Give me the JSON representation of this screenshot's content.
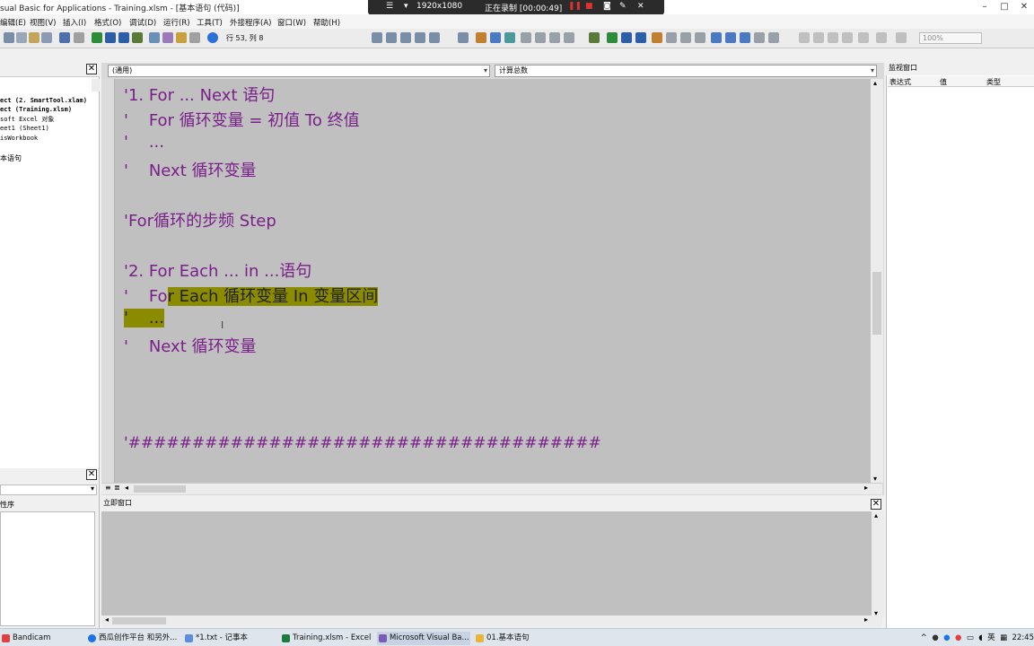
{
  "window": {
    "title": "sual Basic for Applications - Training.xlsm - [基本语句 (代码)]"
  },
  "recorder": {
    "resolution": "1920x1080",
    "status": "正在录制 [00:00:49]"
  },
  "menu": {
    "items": [
      "编辑(E)",
      "视图(V)",
      "插入(I)",
      "格式(O)",
      "调试(D)",
      "运行(R)",
      "工具(T)",
      "外接程序(A)",
      "窗口(W)",
      "帮助(H)"
    ]
  },
  "toolbar": {
    "position": "行 53, 列 8",
    "zoom": "100%"
  },
  "project_panel": {
    "items": [
      "ect (2. SmartTool.xlam)",
      "ect (Training.xlsm)",
      "soft Excel 对象",
      "eet1 (Sheet1)",
      "isWorkbook",
      "本语句"
    ]
  },
  "properties_panel": {
    "label": "性序"
  },
  "code_window": {
    "object_combo": "(通用)",
    "procedure_combo": "计算总数",
    "lines": [
      {
        "text": "'1. For ... Next 语句"
      },
      {
        "text": "'    For 循环变量 = 初值 To 终值"
      },
      {
        "text": "'    ..."
      },
      {
        "text": "'    Next 循环变量"
      },
      {
        "text": ""
      },
      {
        "text": "'For循环的步频 Step"
      },
      {
        "text": ""
      },
      {
        "text": "'2. For Each ... in ...语句"
      },
      {
        "text_pre": "'    Fo",
        "text_hl": "r Each 循环变量 In 变量区间"
      },
      {
        "text_hl": "'    ..."
      },
      {
        "text": "'    Next 循环变量"
      },
      {
        "text": ""
      },
      {
        "text": ""
      },
      {
        "text": ""
      },
      {
        "text": "'#####################################"
      }
    ]
  },
  "watch": {
    "title": "监视窗口",
    "columns": [
      "表达式",
      "值",
      "类型"
    ]
  },
  "immediate": {
    "title": "立即窗口"
  },
  "taskbar": {
    "items": [
      {
        "label": "Bandicam",
        "color": "#e04040"
      },
      {
        "label": "西瓜创作平台 和另外...",
        "color": "#1a73e8"
      },
      {
        "label": "*1.txt - 记事本",
        "color": "#5b8fd9"
      },
      {
        "label": "Training.xlsm - Excel",
        "color": "#1d7a3e"
      },
      {
        "label": "Microsoft Visual Ba...",
        "color": "#7a5bb8"
      },
      {
        "label": "01.基本语句",
        "color": "#e8b53a"
      }
    ],
    "tray_ime": "英",
    "tray_time": "22:45"
  },
  "colors": {
    "code_text": "#7a1f8a",
    "highlight": "#8b8b00",
    "code_bg": "#c0c0c0"
  }
}
